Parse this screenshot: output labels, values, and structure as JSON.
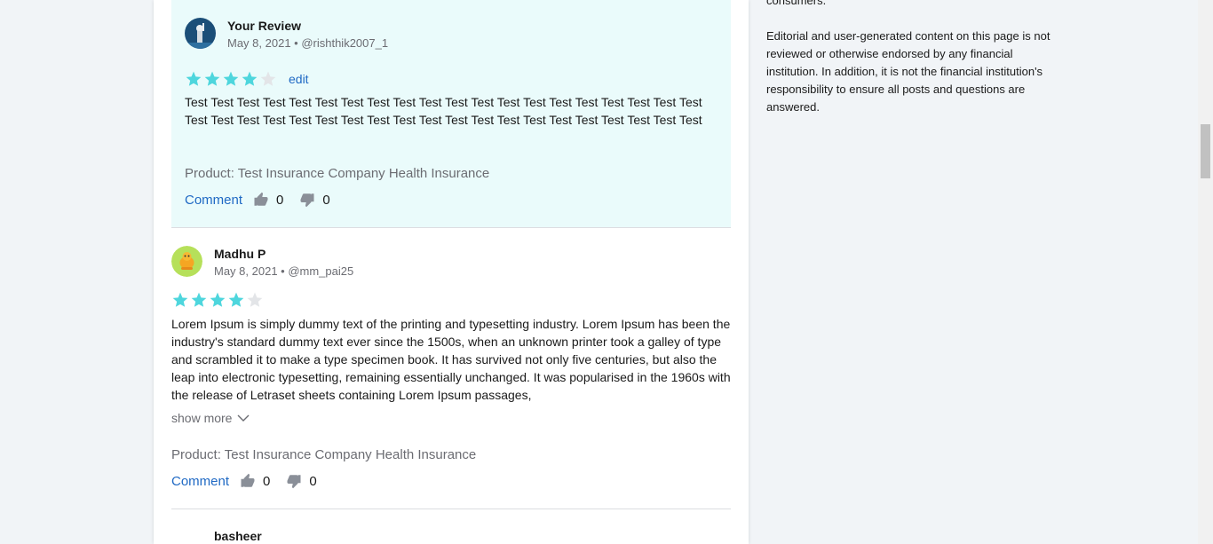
{
  "colors": {
    "accent": "#1f69c4",
    "star_filled": "#4ed6dd",
    "star_empty": "#e3e5e8",
    "own_review_bg": "#eafbfb",
    "muted_text": "#6b6c72"
  },
  "own_review": {
    "name": "Your Review",
    "date_line": "May 8, 2021 • @rishthik2007_1",
    "rating": 4,
    "edit_label": "edit",
    "text": "Test Test Test Test Test Test Test Test Test Test Test Test Test Test Test Test Test Test Test Test Test Test Test Test Test Test Test Test Test Test Test Test Test Test Test Test Test Test Test Test",
    "product": "Product: Test Insurance Company Health Insurance",
    "comment_label": "Comment",
    "upvotes": "0",
    "downvotes": "0"
  },
  "review_2": {
    "name": "Madhu P",
    "date_line": "May 8, 2021 • @mm_pai25",
    "rating": 4,
    "text": "Lorem Ipsum is simply dummy text of the printing and typesetting industry. Lorem Ipsum has been the industry's standard dummy text ever since the 1500s, when an unknown printer took a galley of type and scrambled it to make a type specimen book. It has survived not only five centuries, but also the leap into electronic typesetting, remaining essentially unchanged. It was popularised in the 1960s with the release of Letraset sheets containing Lorem Ipsum passages,",
    "show_more_label": "show more",
    "product": "Product: Test Insurance Company Health Insurance",
    "comment_label": "Comment",
    "upvotes": "0",
    "downvotes": "0"
  },
  "review_3": {
    "name": "basheer"
  },
  "sidebar": {
    "partial_line": "consumers.",
    "disclaimer": "Editorial and user-generated content on this page is not reviewed or otherwise endorsed by any financial institution. In addition, it is not the financial institution's responsibility to ensure all posts and questions are answered."
  }
}
